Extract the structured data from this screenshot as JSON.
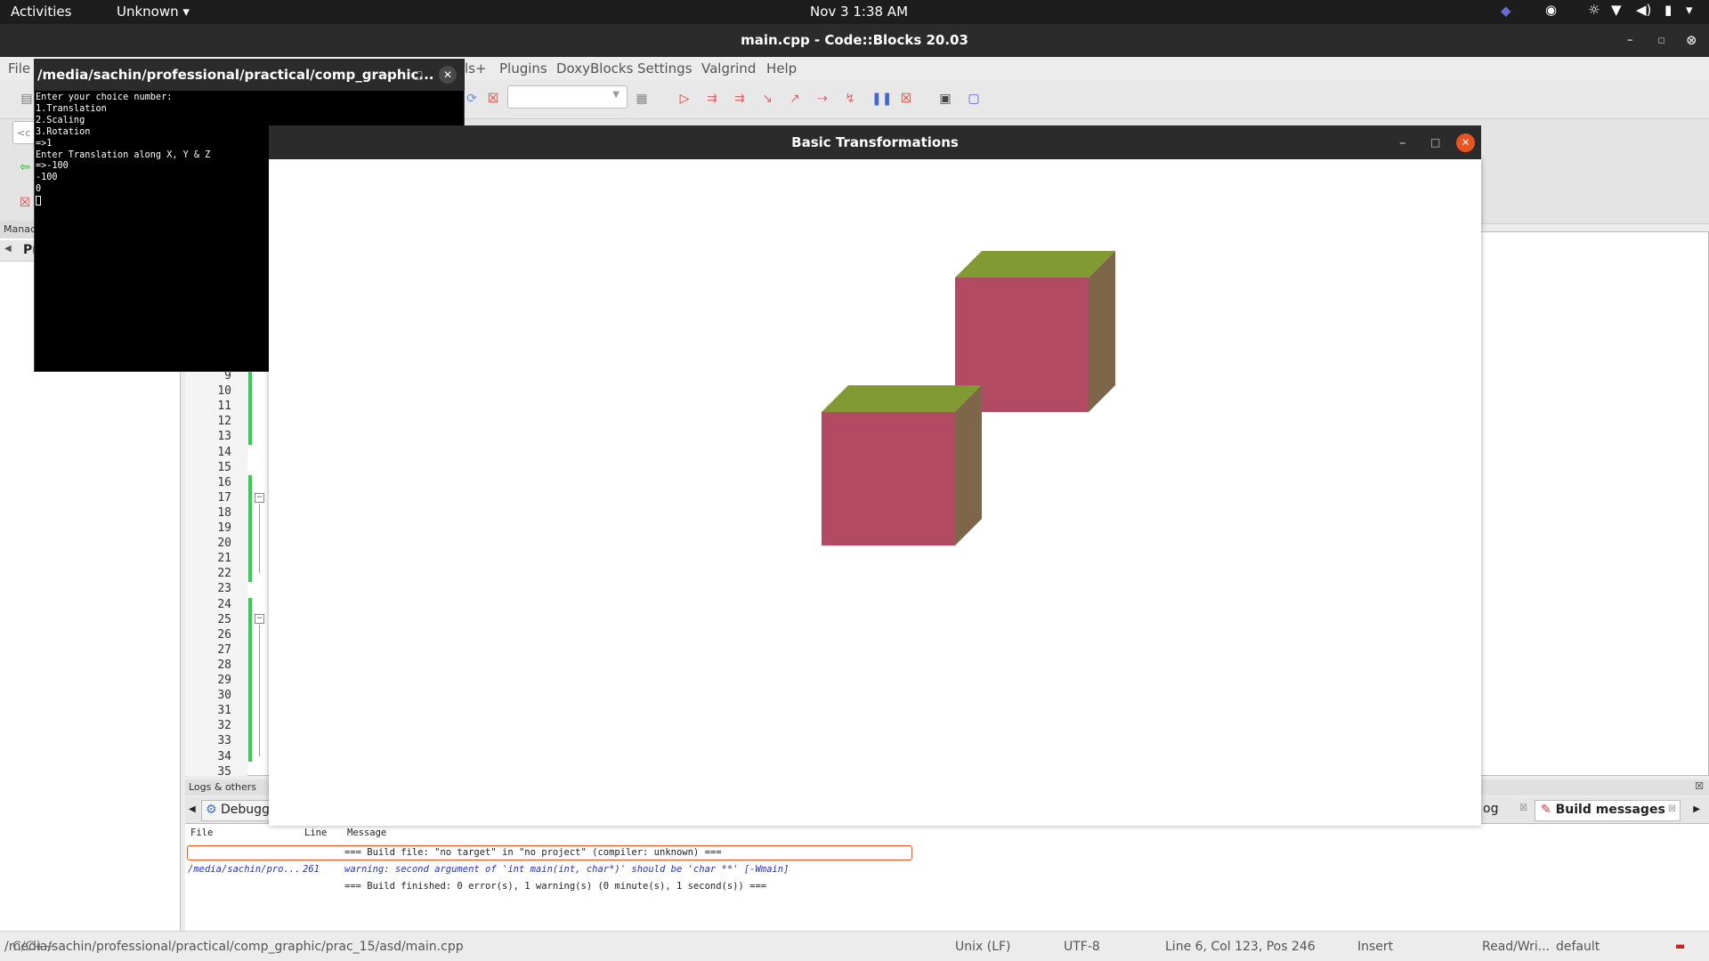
{
  "topbar": {
    "activities": "Activities",
    "app_menu": "Unknown",
    "clock": "Nov 3  1:38 AM"
  },
  "codeblocks": {
    "title": "main.cpp - Code::Blocks 20.03",
    "menu": [
      "File",
      "ls+",
      "Plugins",
      "DoxyBlocks",
      "Settings",
      "Valgrind",
      "Help"
    ],
    "mgmt_label": "Manac",
    "mgmt_tab": "Pr",
    "search_stub": "<c",
    "line_numbers": [
      "9",
      "10",
      "11",
      "12",
      "13",
      "14",
      "15",
      "16",
      "17",
      "18",
      "19",
      "20",
      "21",
      "22",
      "23",
      "24",
      "25",
      "26",
      "27",
      "28",
      "29",
      "30",
      "31",
      "32",
      "33",
      "34",
      "35"
    ],
    "logs_title": "Logs & others",
    "logs_tabs": {
      "debug": "Debugg",
      "log": "og",
      "build": "Build messages"
    },
    "build_columns": {
      "file": "File",
      "line": "Line",
      "message": "Message"
    },
    "build_rows": [
      {
        "file": "",
        "line": "",
        "message": "=== Build file: \"no target\" in \"no project\" (compiler: unknown) ==="
      },
      {
        "file": "/media/sachin/pro...",
        "line": "261",
        "message": "warning: second argument of 'int main(int, char*)' should be 'char **' [-Wmain]"
      },
      {
        "file": "",
        "line": "",
        "message": "=== Build finished: 0 error(s), 1 warning(s) (0 minute(s), 1 second(s)) ==="
      }
    ],
    "status": {
      "path": "/media/sachin/professional/practical/comp_graphic/prac_15/asd/main.cpp",
      "overlap": "C/C++",
      "eol": "Unix (LF)",
      "encoding": "UTF-8",
      "position": "Line 6, Col 123, Pos 246",
      "mode": "Insert",
      "access": "Read/Wri...",
      "profile": "default"
    }
  },
  "terminal": {
    "title": "/media/sachin/professional/practical/comp_graphic...",
    "text": "Enter your choice number:\n1.Translation\n2.Scaling\n3.Rotation\n=>1\nEnter Translation along X, Y & Z\n=>-100\n-100\n0\n"
  },
  "graphics": {
    "title": "Basic Transformations"
  },
  "colors": {
    "cube_front": "#b34a63",
    "cube_top": "#829a34",
    "cube_side": "#7d6649",
    "change_bar": "#2bd44a",
    "close_orange": "#e95420"
  }
}
